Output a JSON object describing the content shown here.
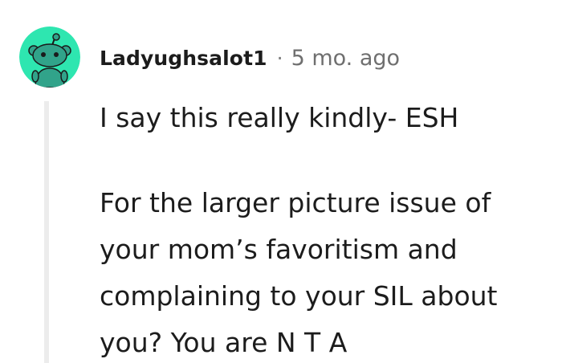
{
  "comment": {
    "avatar_icon": "reddit-snoo-avatar-icon",
    "avatar_bg_color": "#2ee6b0",
    "username": "Ladyughsalot1",
    "separator": "·",
    "timestamp": "5 mo. ago",
    "body": [
      "I say this really kindly- ESH",
      "For the larger picture issue of your mom’s favoritism and complaining to your SIL about you? You are N T A"
    ]
  }
}
